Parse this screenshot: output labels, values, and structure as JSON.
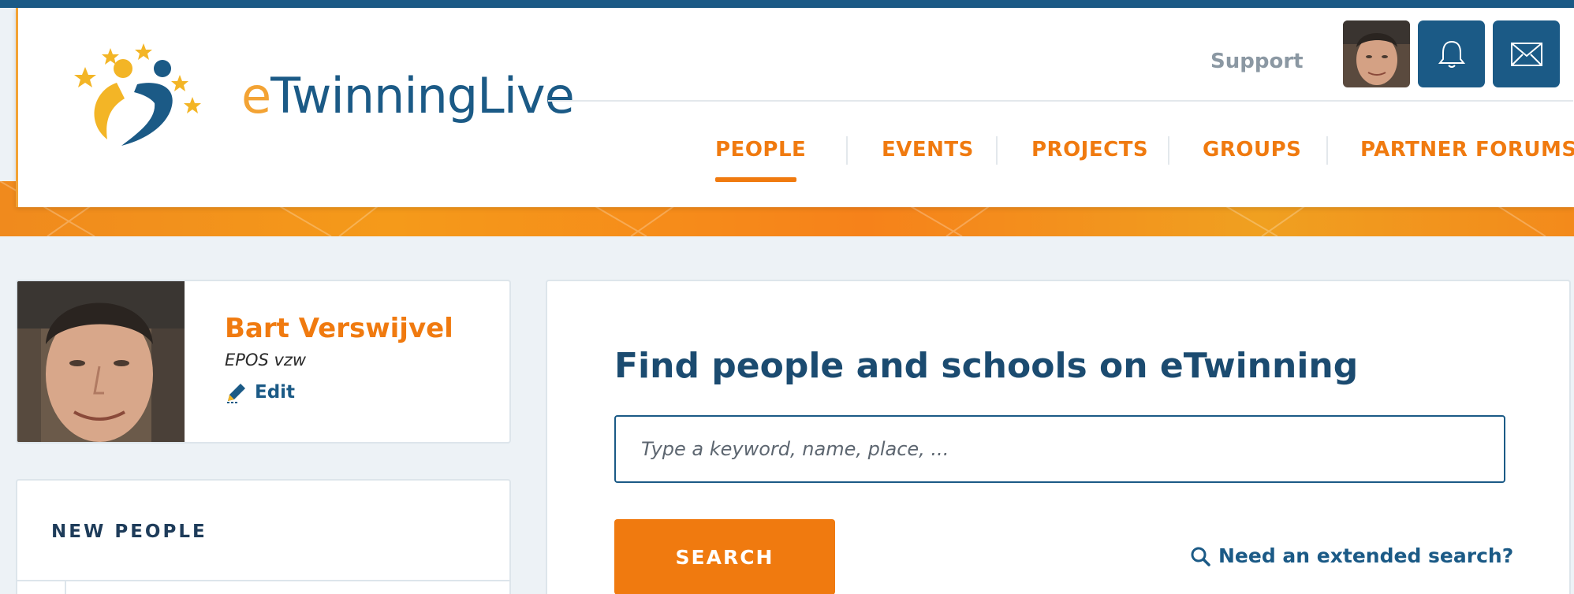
{
  "header": {
    "logo_prefix": "e",
    "logo_text": "TwinningLive",
    "support_label": "Support",
    "nav": [
      {
        "label": "PEOPLE",
        "active": true
      },
      {
        "label": "EVENTS",
        "active": false
      },
      {
        "label": "PROJECTS",
        "active": false
      },
      {
        "label": "GROUPS",
        "active": false
      },
      {
        "label": "PARTNER FORUMS",
        "active": false
      }
    ],
    "icons": [
      "user-avatar",
      "bell-icon",
      "mail-icon"
    ]
  },
  "profile": {
    "name": "Bart Verswijvel",
    "organization": "EPOS vzw",
    "edit_label": "Edit"
  },
  "new_people": {
    "title": "NEW PEOPLE"
  },
  "search": {
    "title": "Find people and schools on eTwinning",
    "placeholder": "Type a keyword, name, place, ...",
    "button_label": "SEARCH",
    "extended_label": "Need an extended search?"
  },
  "colors": {
    "brand_blue": "#1b5a86",
    "accent_orange": "#f07a0f",
    "logo_yellow": "#f3b526"
  }
}
